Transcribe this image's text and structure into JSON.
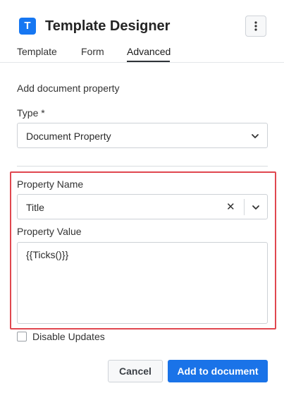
{
  "header": {
    "logo_letter": "T",
    "title": "Template Designer",
    "menu_icon": "kebab-vertical-icon"
  },
  "tabs": [
    {
      "label": "Template",
      "active": false
    },
    {
      "label": "Form",
      "active": false
    },
    {
      "label": "Advanced",
      "active": true
    }
  ],
  "form": {
    "section_title": "Add document property",
    "type_label": "Type *",
    "type_value": "Document Property",
    "property_name_label": "Property Name",
    "property_name_value": "Title",
    "property_value_label": "Property Value",
    "property_value_text": "{{Ticks()}}",
    "disable_updates_label": "Disable Updates",
    "disable_updates_checked": false
  },
  "buttons": {
    "cancel": "Cancel",
    "add": "Add to document"
  },
  "colors": {
    "accent": "#1a73e8",
    "logo": "#1677f2",
    "highlight": "#e0474f"
  }
}
